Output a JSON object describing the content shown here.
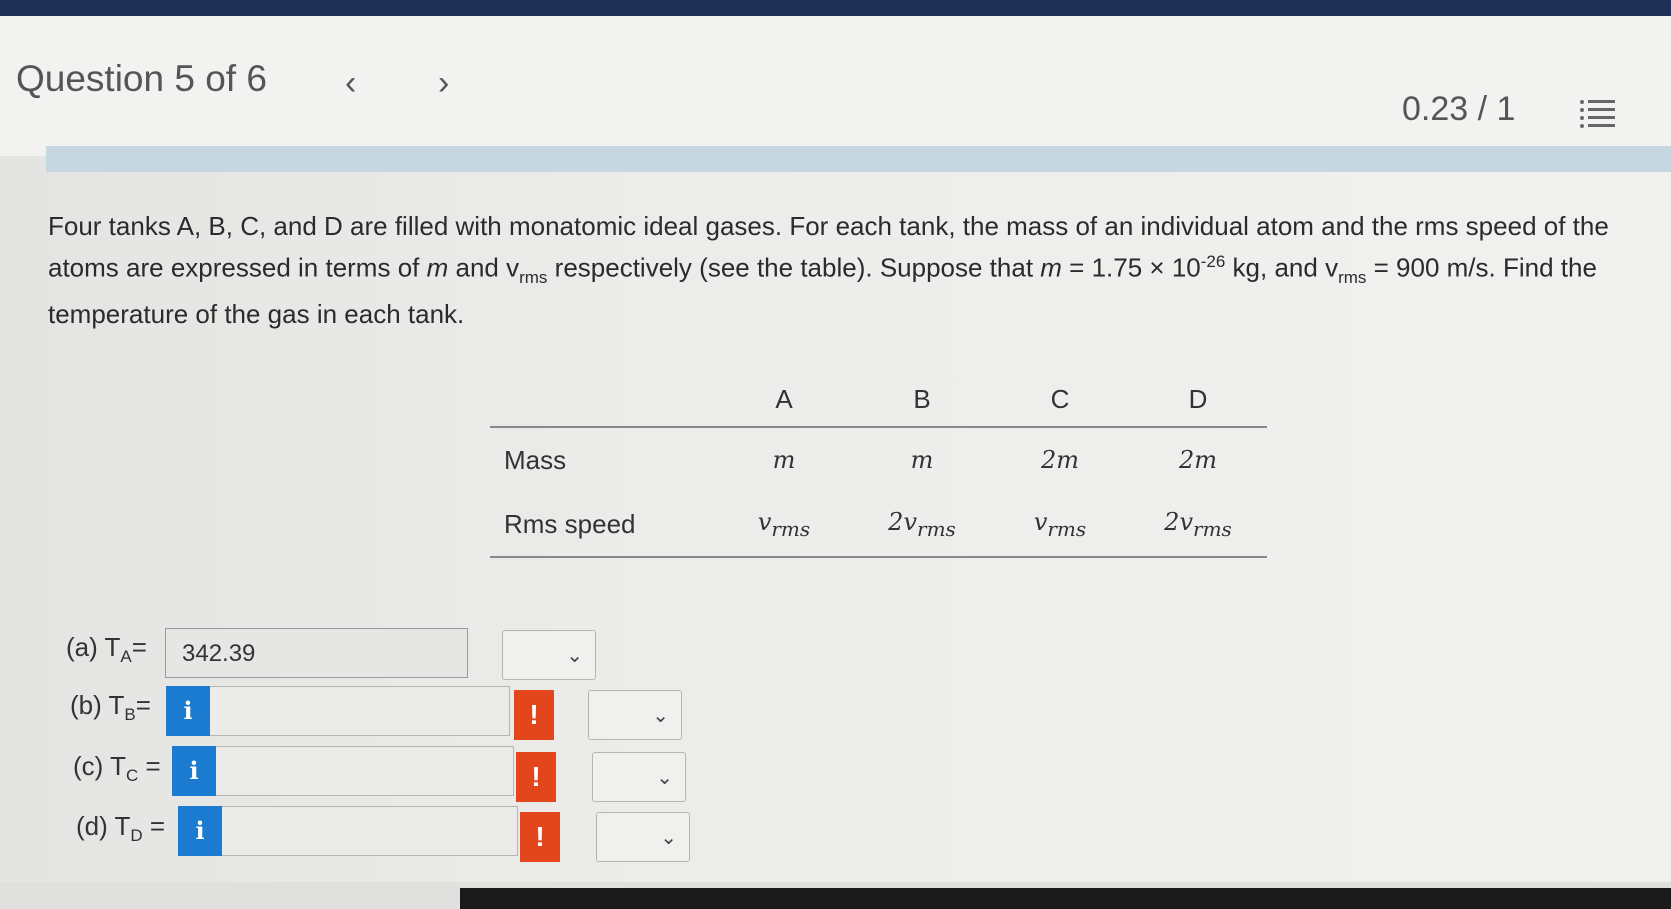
{
  "header": {
    "title": "Question 5 of 6",
    "prev_glyph": "‹",
    "next_glyph": "›",
    "score": "0.23 / 1"
  },
  "problem": {
    "p1": "Four tanks A, B, C, and D are filled with monatomic ideal gases. For each tank, the mass of an individual atom and the rms speed of the atoms are expressed in terms of ",
    "m_sym": "m",
    "p2": " and v",
    "rms_sub": "rms",
    "p3": " respectively (see the table). Suppose that ",
    "m_sym2": "m",
    "p4": " = 1.75 × 10",
    "exp": "-26",
    "p5": " kg, and v",
    "rms_sub2": "rms",
    "p6": " = 900 m/s. Find the temperature of the gas in each tank."
  },
  "table": {
    "headers": [
      "A",
      "B",
      "C",
      "D"
    ],
    "mass_label": "Mass",
    "speed_label": "Rms speed",
    "mass": [
      "m",
      "m",
      "2m",
      "2m"
    ],
    "speed_prefix": [
      "",
      "2",
      "",
      "2"
    ],
    "speed_var": "v",
    "speed_sub": "rms"
  },
  "answers": {
    "a_label": "(a) T",
    "a_sub": "A",
    "a_eq": "=",
    "a_value": "342.39",
    "b_label": "(b) T",
    "b_sub": "B",
    "b_eq": "=",
    "c_label": "(c) T",
    "c_sub": "C",
    "c_eq": " =",
    "d_label": "(d) T",
    "d_sub": "D",
    "d_eq": " =",
    "info_glyph": "i",
    "warn_glyph": "!",
    "chevron": "⌄"
  }
}
